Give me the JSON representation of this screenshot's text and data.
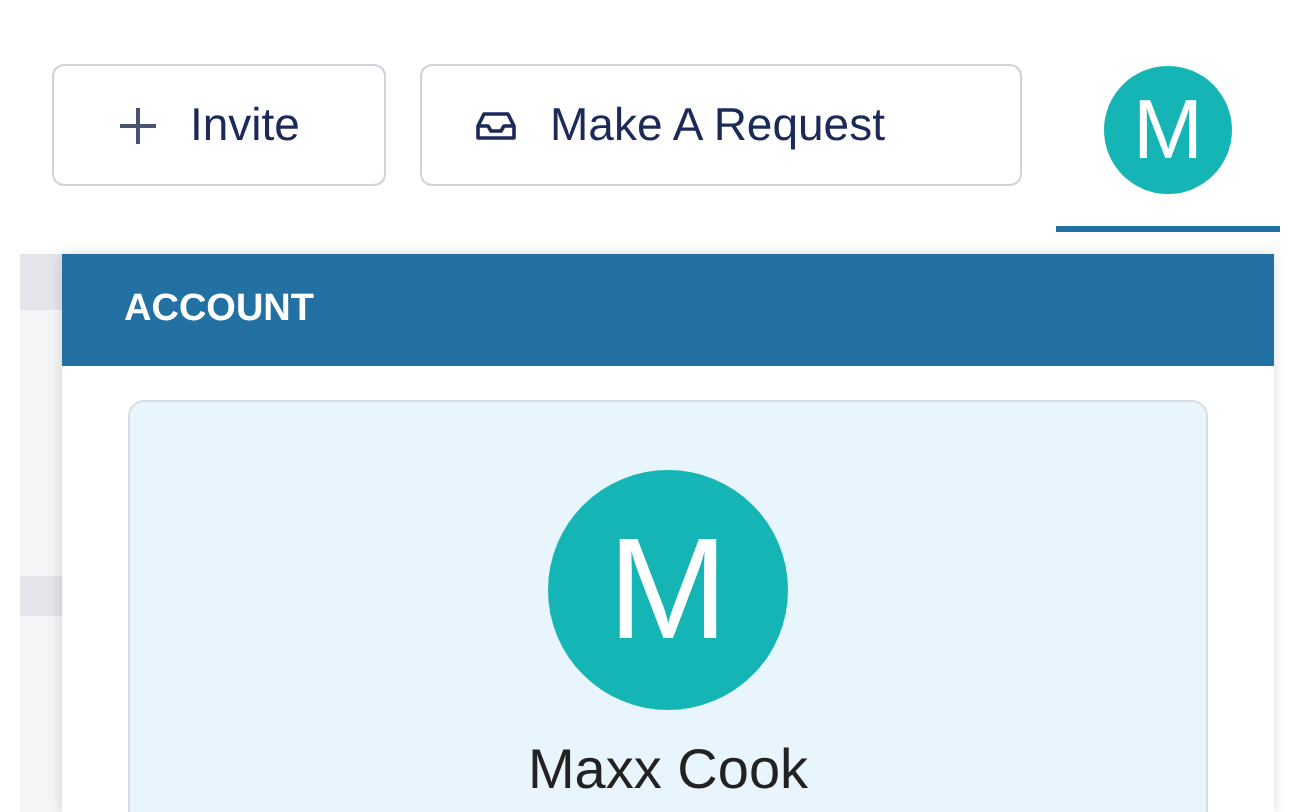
{
  "toolbar": {
    "buttons": [
      {
        "kind": "invite",
        "label": "Invite"
      },
      {
        "kind": "request",
        "label": "Make A Request"
      }
    ],
    "avatar": {
      "initial": "M",
      "selected": true
    }
  },
  "account_menu": {
    "title": "ACCOUNT",
    "profile": {
      "initial": "M",
      "name": "Maxx Cook"
    }
  }
}
